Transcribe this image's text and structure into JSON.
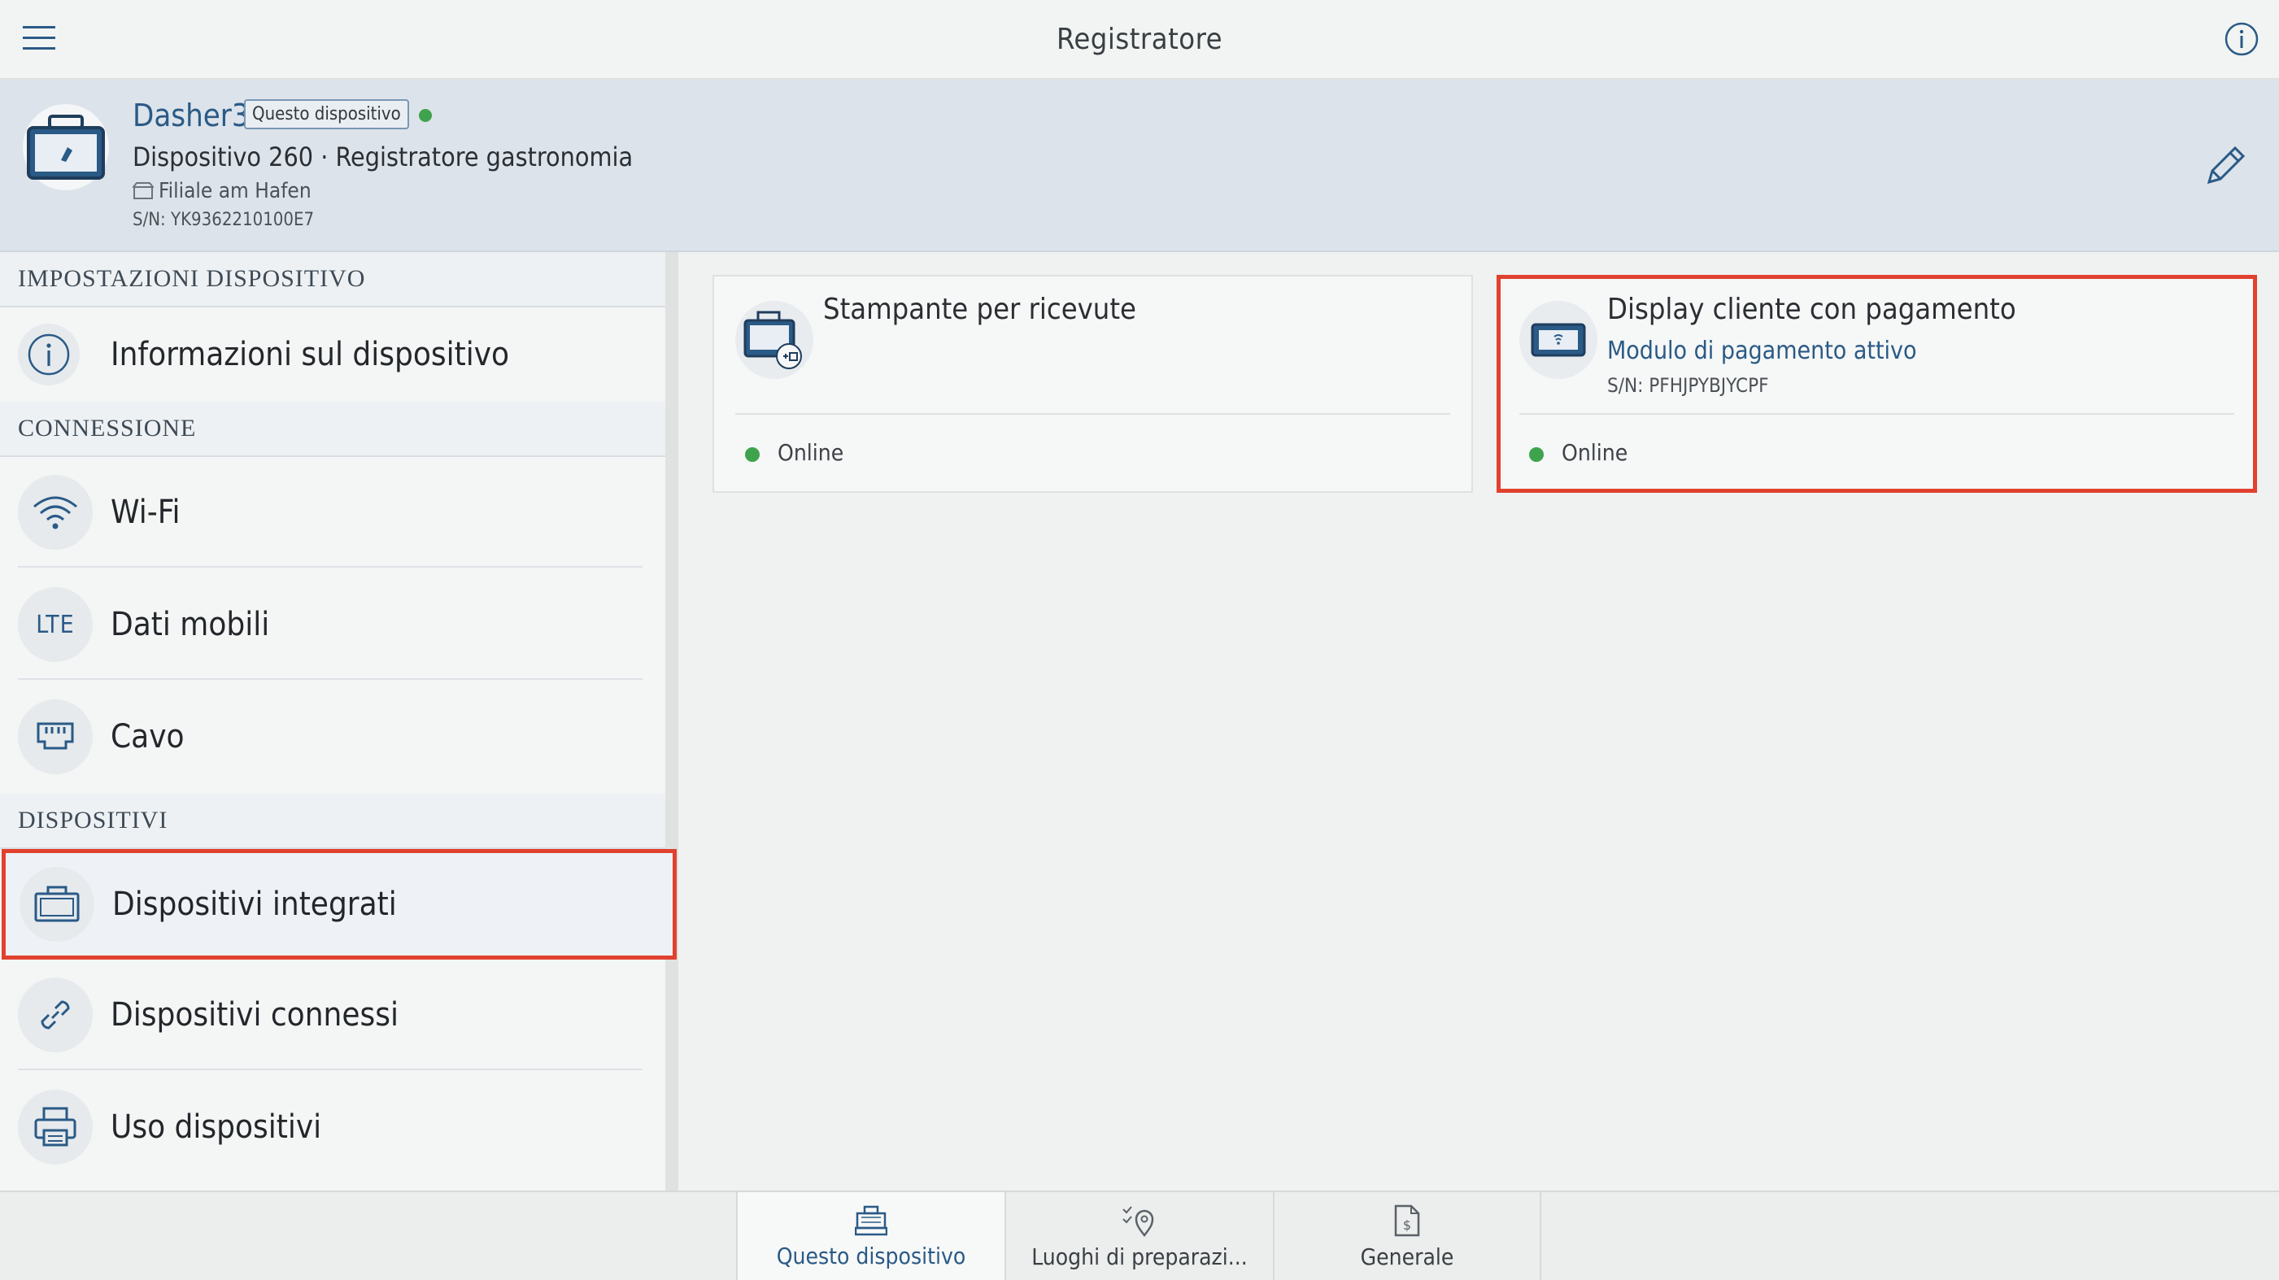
{
  "app": {
    "title": "Registratore"
  },
  "device": {
    "name": "Dasher3",
    "badge": "Questo dispositivo",
    "model": "Dispositivo 260 · Registratore gastronomia",
    "location": "Filiale am Hafen",
    "serial": "S/N: YK9362210100E7",
    "status_color": "#3fa34d"
  },
  "sidebar": {
    "section_settings": "IMPOSTAZIONI DISPOSITIVO",
    "section_connection": "CONNESSIONE",
    "section_devices": "DISPOSITIVI",
    "items": [
      {
        "label": "Informazioni sul dispositivo",
        "icon": "info-icon"
      },
      {
        "label": "Wi-Fi",
        "icon": "wifi-icon"
      },
      {
        "label": "Dati mobili",
        "icon": "lte-icon",
        "icon_text": "LTE"
      },
      {
        "label": "Cavo",
        "icon": "ethernet-icon"
      },
      {
        "label": "Dispositivi integrati",
        "icon": "register-icon",
        "selected": true
      },
      {
        "label": "Dispositivi connessi",
        "icon": "link-icon"
      },
      {
        "label": "Uso dispositivi",
        "icon": "printer-icon"
      }
    ]
  },
  "cards": [
    {
      "title": "Stampante per ricevute",
      "status": "Online",
      "icon": "receipt-printer-icon"
    },
    {
      "title": "Display cliente con pagamento",
      "subtitle": "Modulo di pagamento attivo",
      "serial": "S/N: PFHJPYBJYCPF",
      "status": "Online",
      "icon": "customer-display-icon",
      "selected": true
    }
  ],
  "tabs": [
    {
      "label": "Questo dispositivo",
      "icon": "register-icon",
      "active": true
    },
    {
      "label": "Luoghi di preparazi...",
      "icon": "location-check-icon"
    },
    {
      "label": "Generale",
      "icon": "document-dollar-icon"
    }
  ],
  "colors": {
    "accent": "#2a5a86",
    "highlight": "#e1412f",
    "online": "#3fa34d"
  }
}
